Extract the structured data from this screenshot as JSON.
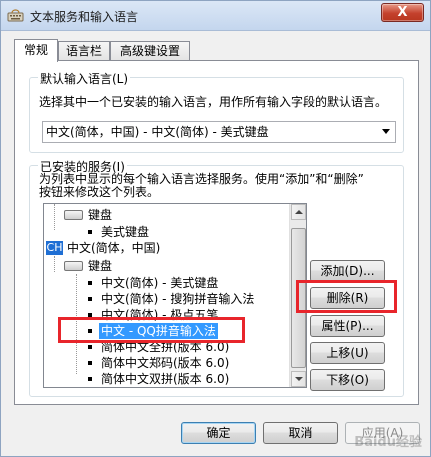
{
  "window": {
    "title": "文本服务和输入语言",
    "close_label": "X"
  },
  "tabs": [
    {
      "label": "常规",
      "active": true
    },
    {
      "label": "语言栏",
      "active": false
    },
    {
      "label": "高级键设置",
      "active": false
    }
  ],
  "default_lang": {
    "legend": "默认输入语言(L)",
    "description": "选择其中一个已安装的输入语言，用作所有输入字段的默认语言。",
    "selected": "中文(简体，中国) - 中文(简体) - 美式键盘"
  },
  "installed": {
    "legend": "已安装的服务(I)",
    "description_1": "为列表中显示的每个输入语言选择服务。使用“添加”和“删除”",
    "description_2": "按钮来修改这个列表。",
    "tree": {
      "kbd_label_1": "键盘",
      "item_us": "美式键盘",
      "lang_badge": "CH",
      "lang_label": "中文(简体，中国)",
      "kbd_label_2": "键盘",
      "items": [
        "中文(简体) - 美式键盘",
        "中文(简体) - 搜狗拼音输入法",
        "中文(简体) - 极点五笔",
        "中文 - QQ拼音输入法",
        "简体中文全拼(版本 6.0)",
        "简体中文郑码(版本 6.0)",
        "简体中文双拼(版本 6.0)"
      ],
      "selected_index": 3
    },
    "buttons": {
      "add": "添加(D)...",
      "remove": "删除(R)",
      "properties": "属性(P)...",
      "move_up": "上移(U)",
      "move_down": "下移(O)"
    }
  },
  "footer": {
    "ok": "确定",
    "cancel": "取消",
    "apply": "应用(A)"
  },
  "watermark": "Baidu经验",
  "colors": {
    "highlight": "#e8252b",
    "selection": "#3399ff",
    "badge": "#1f6fd4"
  }
}
